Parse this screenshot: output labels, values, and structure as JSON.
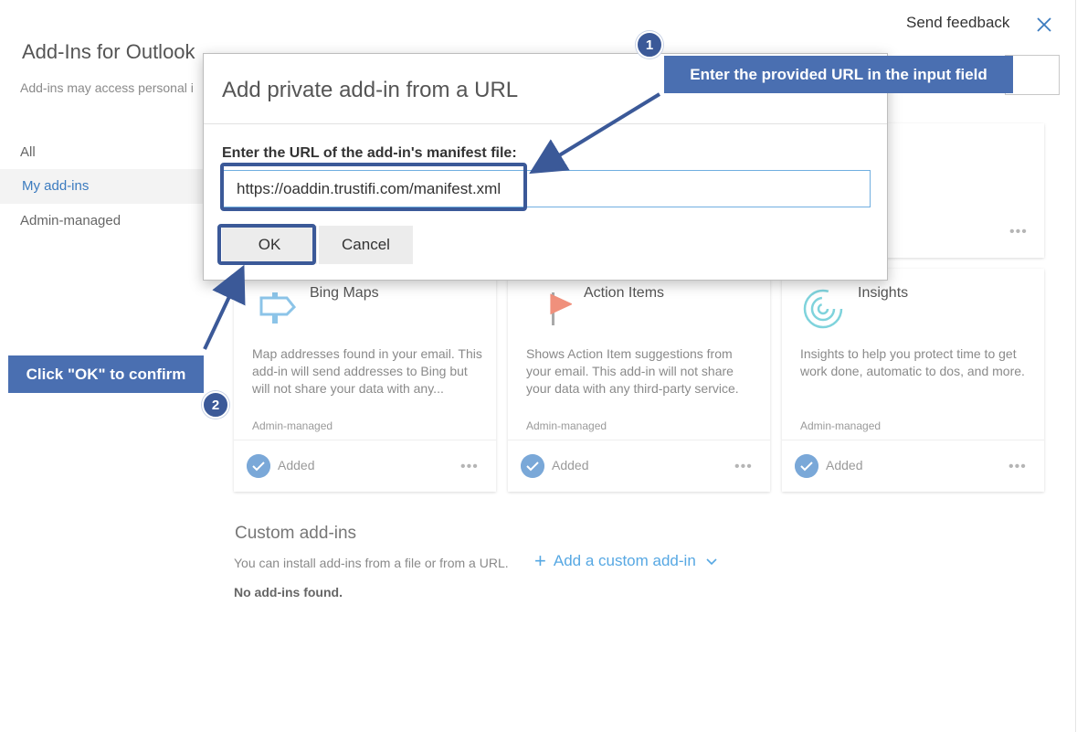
{
  "header": {
    "app_title": "Add-Ins for Outlook",
    "app_subtitle": "Add-ins may access personal i",
    "send_feedback": "Send feedback"
  },
  "nav": {
    "items": [
      {
        "label": "All"
      },
      {
        "label": "My add-ins"
      },
      {
        "label": "Admin-managed"
      }
    ],
    "selected": "My add-ins"
  },
  "cards": [
    {
      "title": "Bing Maps",
      "icon": "signpost-icon",
      "description": "Map addresses found in your email. This add-in will send addresses to Bing but will not share your data with any...",
      "managed": "Admin-managed",
      "status": "Added"
    },
    {
      "title": "Action Items",
      "icon": "flag-icon",
      "description": "Shows Action Item suggestions from your email. This add-in will not share your data with any third-party service.",
      "managed": "Admin-managed",
      "status": "Added"
    },
    {
      "title": "Insights",
      "icon": "insights-spiral-icon",
      "description": "Insights to help you protect time to get work done, automatic to dos, and more.",
      "managed": "Admin-managed",
      "status": "Added"
    }
  ],
  "custom": {
    "title": "Custom add-ins",
    "subtitle": "You can install add-ins from a file or from a URL.",
    "add_link": "Add a custom add-in",
    "empty_text": "No add-ins found."
  },
  "dialog": {
    "title": "Add private add-in from a URL",
    "label": "Enter the URL of the add-in's manifest file:",
    "url_value": "https://oaddin.trustifi.com/manifest.xml",
    "ok_label": "OK",
    "cancel_label": "Cancel"
  },
  "annotations": {
    "step1": {
      "number": "1",
      "text": "Enter the provided URL in the input field"
    },
    "step2": {
      "number": "2",
      "text": "Click \"OK\" to confirm"
    }
  },
  "colors": {
    "accent": "#3b7bbf",
    "link": "#57a8e3",
    "callout": "#4a6fb1",
    "highlight": "#3b5998",
    "added_check": "#7aa8d8"
  }
}
